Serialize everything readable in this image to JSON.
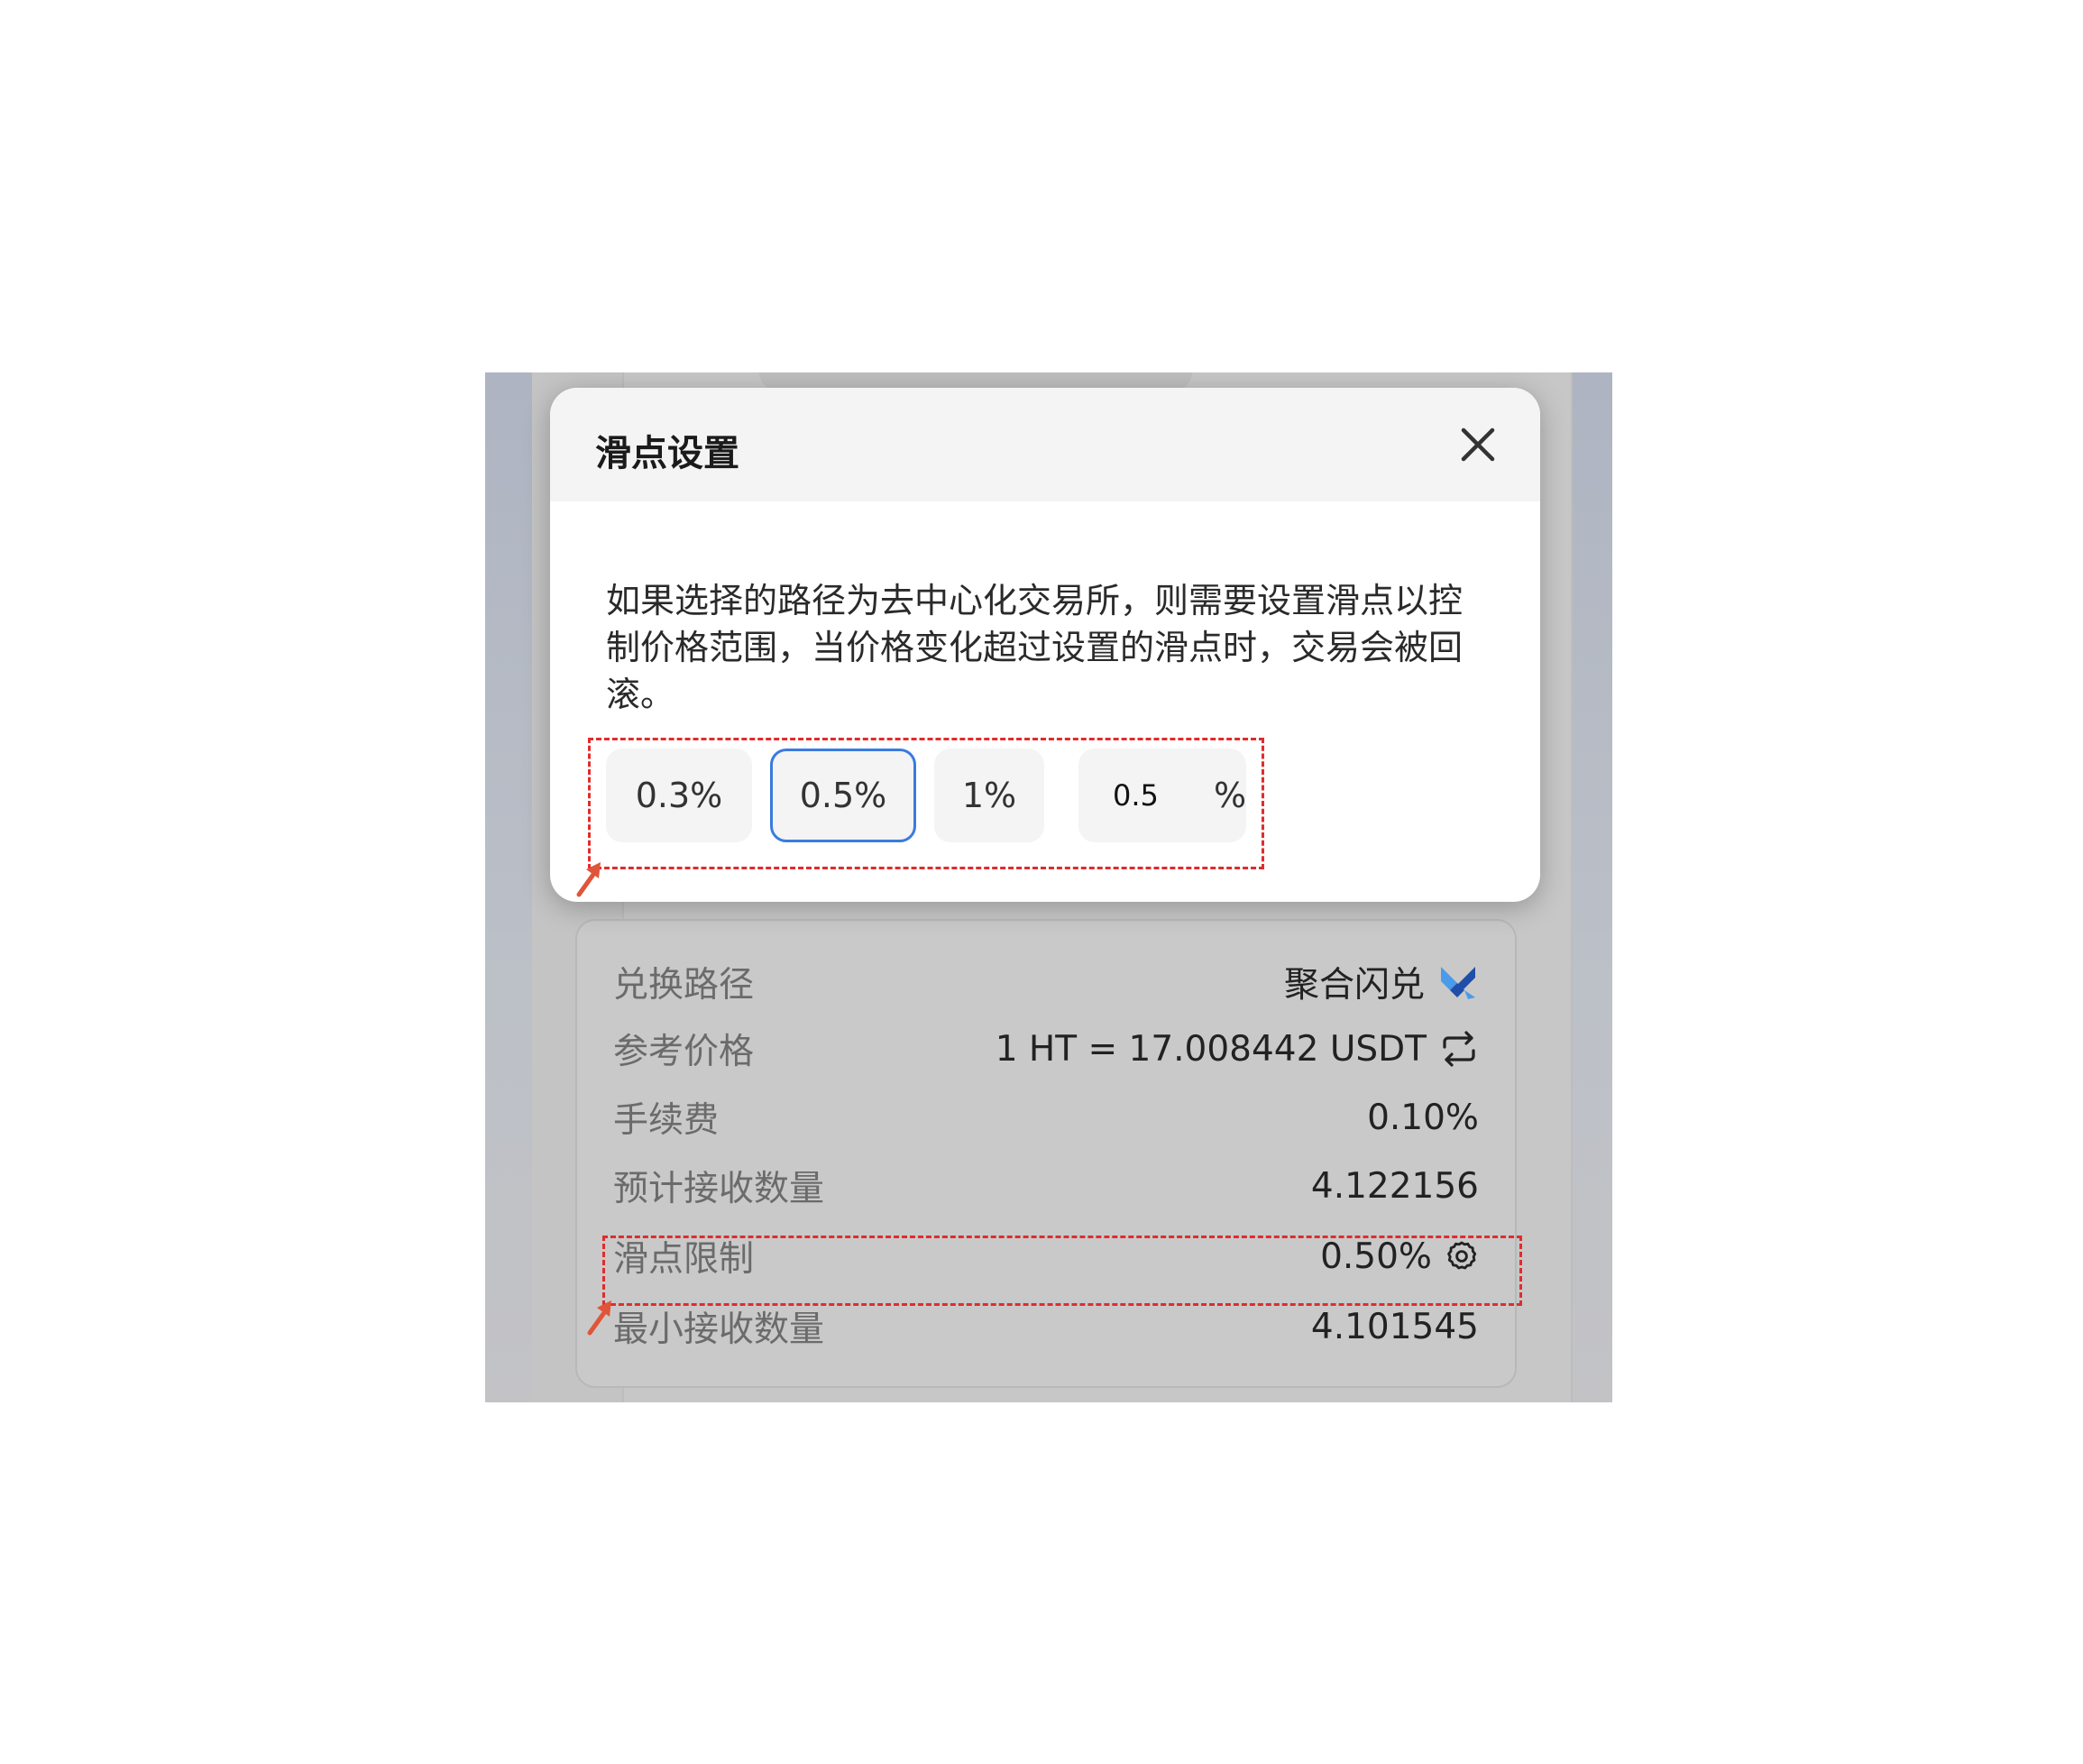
{
  "modal": {
    "title": "滑点设置",
    "description": "如果选择的路径为去中心化交易所，则需要设置滑点以控制价格范围，当价格变化超过设置的滑点时，交易会被回滚。",
    "options": [
      "0.3%",
      "0.5%",
      "1%"
    ],
    "selected_option": "0.5%",
    "custom_value": "0.5",
    "custom_unit": "%"
  },
  "info": {
    "route_label": "兑换路径",
    "route_value": "聚合闪兑",
    "price_label": "参考价格",
    "price_value": "1 HT = 17.008442 USDT",
    "fee_label": "手续费",
    "fee_value": "0.10%",
    "expected_label": "预计接收数量",
    "expected_value": "4.122156",
    "slippage_label": "滑点限制",
    "slippage_value": "0.50%",
    "min_label": "最小接收数量",
    "min_value": "4.101545"
  },
  "icons": {
    "close": "close-icon",
    "route_logo": "aggregator-logo-icon",
    "swap": "swap-direction-icon",
    "settings": "gear-icon"
  },
  "colors": {
    "selected_border": "#3a7be0",
    "annotation": "#e02c2c",
    "arrow": "#e0553a",
    "logo_dark": "#1f4fa8",
    "logo_light": "#4a9bea"
  }
}
